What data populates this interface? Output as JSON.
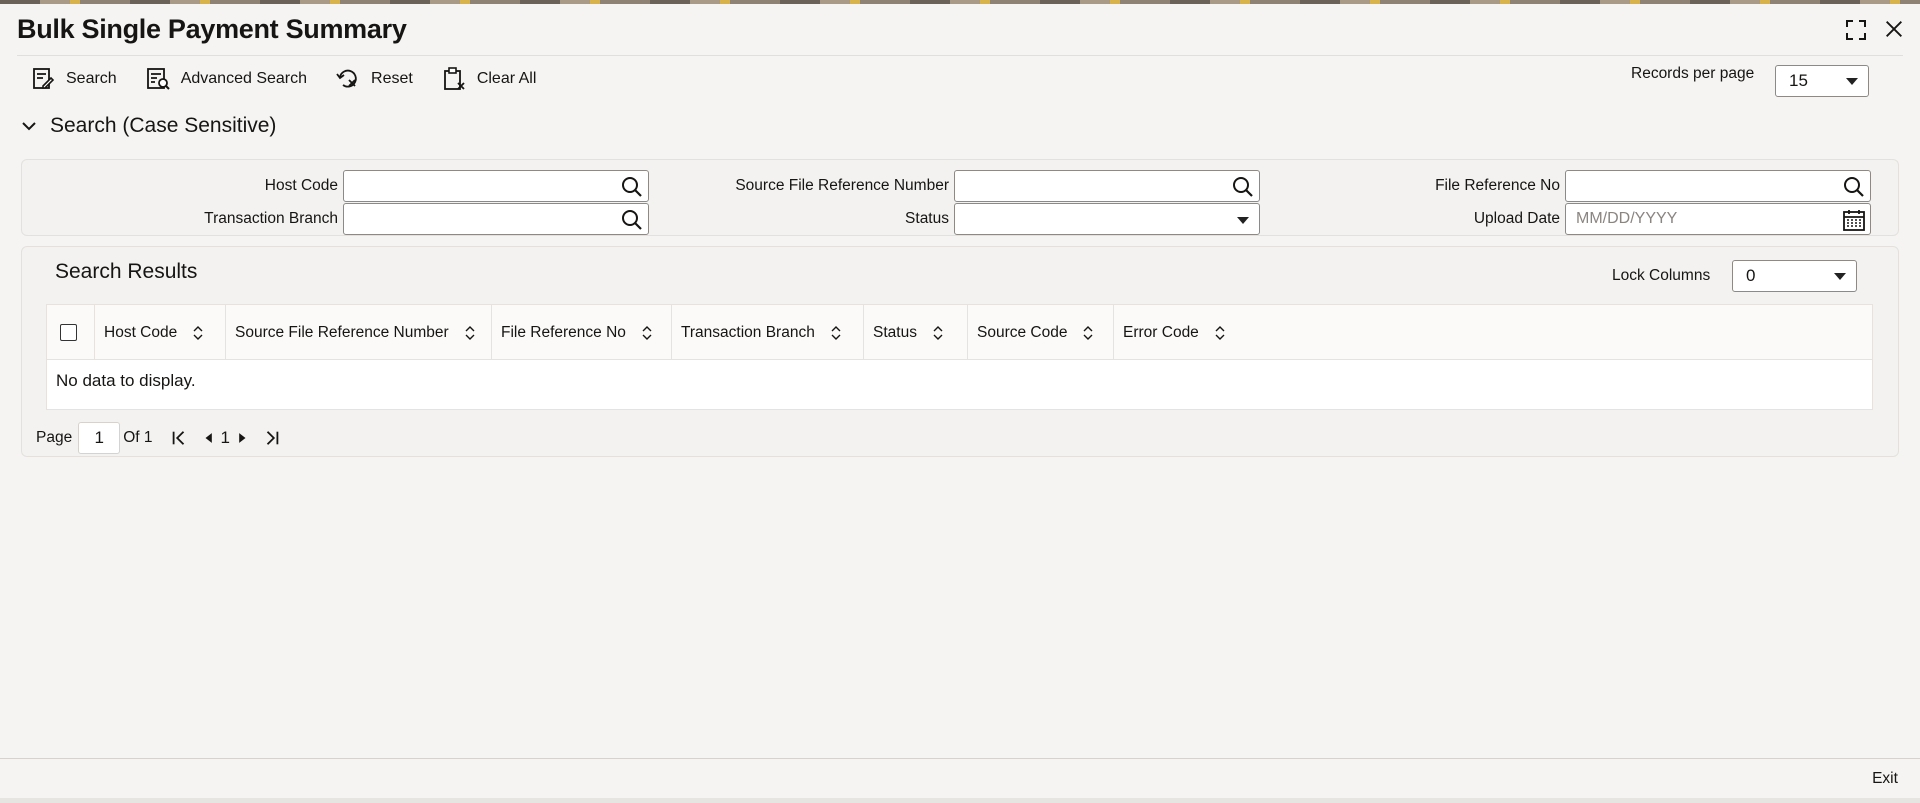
{
  "header": {
    "title": "Bulk Single Payment Summary"
  },
  "toolbar": {
    "search_label": "Search",
    "advanced_search_label": "Advanced Search",
    "reset_label": "Reset",
    "clear_all_label": "Clear All",
    "records_per_page_label": "Records per page",
    "records_per_page_value": "15"
  },
  "search_section": {
    "heading": "Search (Case Sensitive)",
    "host_code_label": "Host Code",
    "transaction_branch_label": "Transaction Branch",
    "source_file_ref_label": "Source File Reference Number",
    "status_label": "Status",
    "file_ref_label": "File Reference No",
    "upload_date_label": "Upload Date",
    "upload_date_placeholder": "MM/DD/YYYY"
  },
  "results": {
    "title": "Search Results",
    "lock_columns_label": "Lock Columns",
    "lock_columns_value": "0",
    "columns": [
      "Host Code",
      "Source File Reference Number",
      "File Reference No",
      "Transaction Branch",
      "Status",
      "Source Code",
      "Error Code"
    ],
    "empty_message": "No data to display."
  },
  "pager": {
    "page_label": "Page",
    "page_value": "1",
    "of_label": "Of 1",
    "current_page": "1"
  },
  "footer": {
    "exit_label": "Exit"
  }
}
